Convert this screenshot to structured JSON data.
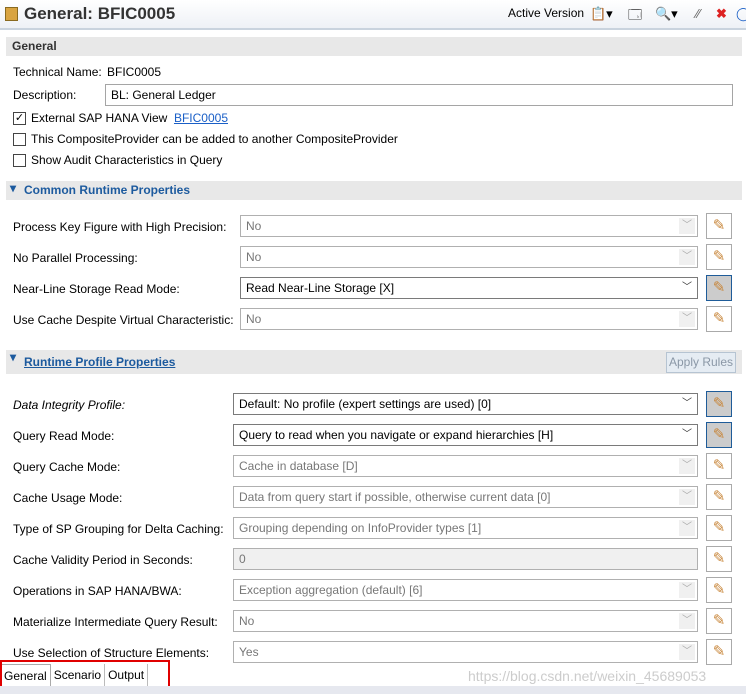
{
  "header": {
    "title": "General: BFIC0005",
    "version": "Active Version"
  },
  "general": {
    "section": "General",
    "tech_label": "Technical Name:",
    "tech_value": "BFIC0005",
    "desc_label": "Description:",
    "desc_value": "BL: General Ledger",
    "checks": [
      {
        "label": "External SAP HANA View",
        "checked": true,
        "link": "BFIC0005"
      },
      {
        "label": "This CompositeProvider can be added to another CompositeProvider",
        "checked": false
      },
      {
        "label": "Show Audit Characteristics in Query",
        "checked": false
      }
    ]
  },
  "common": {
    "section": "Common Runtime Properties",
    "rows": [
      {
        "label": "Process Key Figure with High Precision:",
        "value": "No",
        "enabled": false
      },
      {
        "label": "No Parallel Processing:",
        "value": "No",
        "enabled": false
      },
      {
        "label": "Near-Line Storage Read Mode:",
        "value": "Read Near-Line Storage [X]",
        "enabled": true
      },
      {
        "label": "Use Cache Despite Virtual Characteristic:",
        "value": "No",
        "enabled": false
      }
    ]
  },
  "profile": {
    "section": "Runtime Profile Properties",
    "apply": "Apply Rules",
    "rows": [
      {
        "label": "Data Integrity Profile:",
        "value": "Default: No profile (expert settings are used) [0]",
        "enabled": true
      },
      {
        "label": "Query Read Mode:",
        "value": "Query to read when you navigate or expand hierarchies [H]",
        "enabled": true
      },
      {
        "label": "Query Cache Mode:",
        "value": "Cache in database [D]",
        "enabled": false
      },
      {
        "label": "Cache Usage Mode:",
        "value": "Data from query start if possible, otherwise current data [0]",
        "enabled": false
      },
      {
        "label": "Type of SP Grouping for Delta Caching:",
        "value": "Grouping depending on InfoProvider types [1]",
        "enabled": false
      },
      {
        "label": "Cache Validity Period in Seconds:",
        "value": "0",
        "enabled": false,
        "text": true
      },
      {
        "label": "Operations in SAP HANA/BWA:",
        "value": "Exception aggregation (default) [6]",
        "enabled": false
      },
      {
        "label": "Materialize Intermediate Query Result:",
        "value": "No",
        "enabled": false
      },
      {
        "label": "Use Selection of Structure Elements:",
        "value": "Yes",
        "enabled": false
      }
    ]
  },
  "tabs": [
    "General",
    "Scenario",
    "Output"
  ],
  "watermark": "https://blog.csdn.net/weixin_45689053"
}
